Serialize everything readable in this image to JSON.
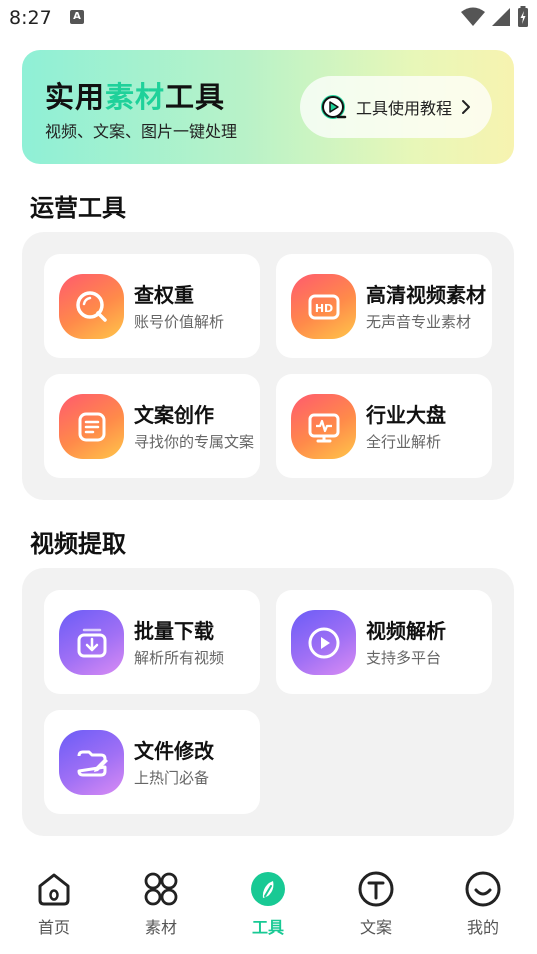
{
  "status_bar": {
    "time": "8:27",
    "app_badge": "A"
  },
  "banner": {
    "title_pre": "实用",
    "title_highlight": "素材",
    "title_post": "工具",
    "subtitle": "视频、文案、图片一键处理",
    "tutorial_label": "工具使用教程"
  },
  "sections": {
    "ops_title": "运营工具",
    "video_title": "视频提取"
  },
  "ops_tools": [
    {
      "title": "查权重",
      "subtitle": "账号价值解析",
      "icon": "search-icon"
    },
    {
      "title": "高清视频素材",
      "subtitle": "无声音专业素材",
      "icon": "hd-icon"
    },
    {
      "title": "文案创作",
      "subtitle": "寻找你的专属文案",
      "icon": "document-icon"
    },
    {
      "title": "行业大盘",
      "subtitle": "全行业解析",
      "icon": "monitor-pulse-icon"
    }
  ],
  "video_tools": [
    {
      "title": "批量下载",
      "subtitle": "解析所有视频",
      "icon": "download-icon"
    },
    {
      "title": "视频解析",
      "subtitle": "支持多平台",
      "icon": "play-icon"
    },
    {
      "title": "文件修改",
      "subtitle": "上热门必备",
      "icon": "folder-edit-icon"
    }
  ],
  "nav": [
    {
      "label": "首页",
      "icon": "home-icon"
    },
    {
      "label": "素材",
      "icon": "grid-icon"
    },
    {
      "label": "工具",
      "icon": "compass-icon",
      "active": true
    },
    {
      "label": "文案",
      "icon": "text-icon"
    },
    {
      "label": "我的",
      "icon": "smile-icon"
    }
  ],
  "colors": {
    "accent": "#18c994",
    "orange_grad": [
      "#ff5a6e",
      "#ffc64a"
    ],
    "purple_grad": [
      "#6b5cf6",
      "#d98cf3"
    ]
  }
}
